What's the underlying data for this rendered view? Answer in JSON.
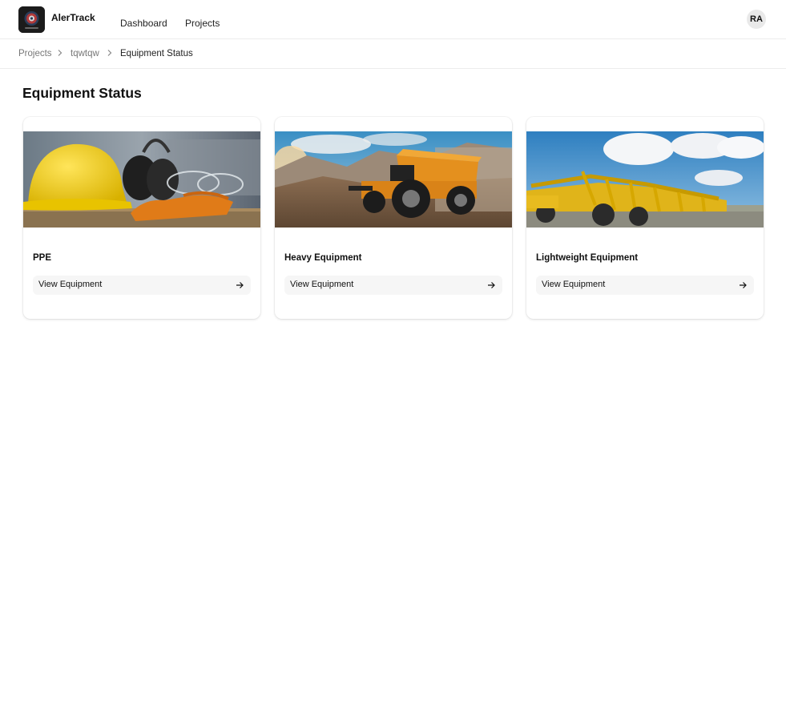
{
  "app": {
    "name": "AlerTrack",
    "logo_icon": "shield-camera-logo"
  },
  "nav": {
    "dashboard": "Dashboard",
    "projects": "Projects"
  },
  "user": {
    "initials": "RA"
  },
  "breadcrumb": {
    "items": [
      "Projects",
      "tqwtqw",
      "Equipment Status"
    ],
    "separator_icon": "chevron-right-icon"
  },
  "page": {
    "title": "Equipment Status"
  },
  "cards": [
    {
      "title": "PPE",
      "button_label": "View Equipment",
      "image": "hard-hat-earmuffs-gloves-photo",
      "arrow_icon": "arrow-right-icon"
    },
    {
      "title": "Heavy Equipment",
      "button_label": "View Equipment",
      "image": "mining-dump-truck-photo",
      "arrow_icon": "arrow-right-icon"
    },
    {
      "title": "Lightweight Equipment",
      "button_label": "View Equipment",
      "image": "yellow-cultivator-machine-photo",
      "arrow_icon": "arrow-right-icon"
    }
  ],
  "colors": {
    "border": "#ececec",
    "button_bg": "#f6f6f6",
    "avatar_bg": "#e9e9e9",
    "logo_bg": "#1b1b1b"
  }
}
